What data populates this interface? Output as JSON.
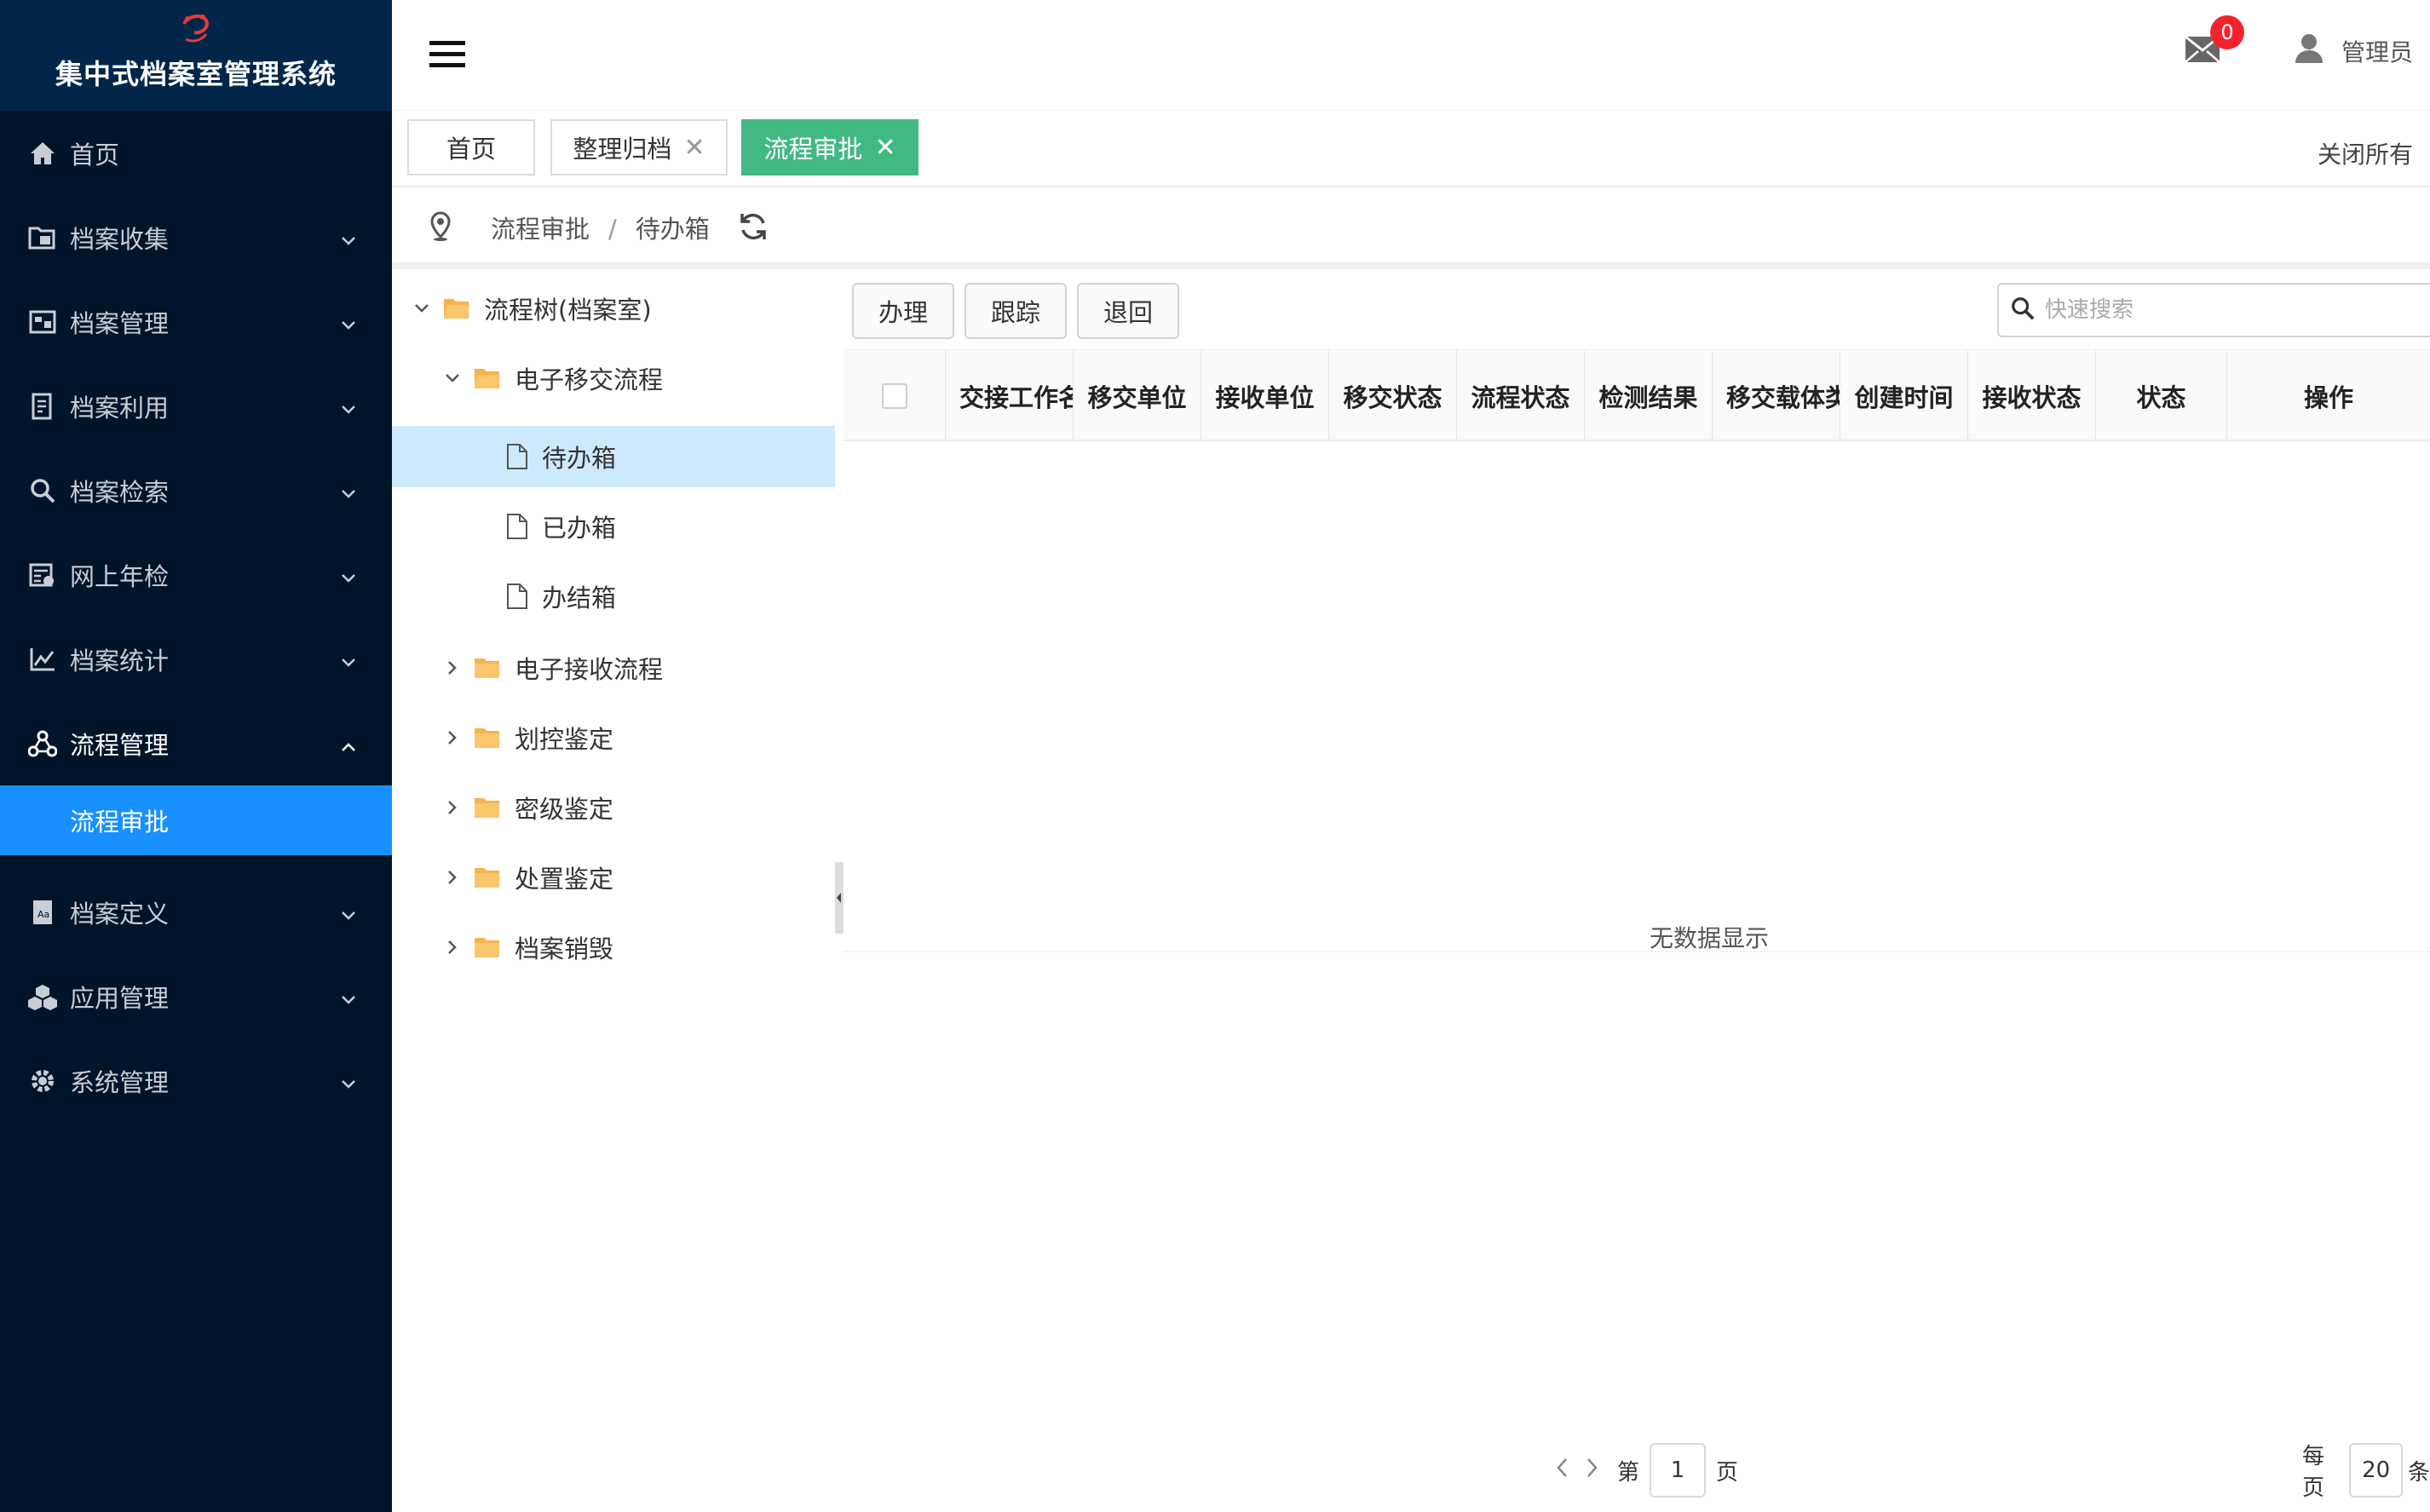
{
  "app": {
    "title": "集中式档案室管理系统"
  },
  "sidebar": {
    "items": [
      {
        "label": "首页",
        "icon": "home-icon"
      },
      {
        "label": "档案收集",
        "icon": "folder-collect-icon"
      },
      {
        "label": "档案管理",
        "icon": "archive-manage-icon"
      },
      {
        "label": "档案利用",
        "icon": "document-use-icon"
      },
      {
        "label": "档案检索",
        "icon": "search-icon"
      },
      {
        "label": "网上年检",
        "icon": "calendar-check-icon"
      },
      {
        "label": "档案统计",
        "icon": "line-chart-icon"
      },
      {
        "label": "流程管理",
        "icon": "workflow-icon"
      },
      {
        "label": "档案定义",
        "icon": "book-define-icon"
      },
      {
        "label": "应用管理",
        "icon": "cubes-icon"
      },
      {
        "label": "系统管理",
        "icon": "gear-icon"
      }
    ],
    "active_sub": "流程审批"
  },
  "header": {
    "mail_count": "0",
    "user": "管理员"
  },
  "tabs": {
    "items": [
      "首页",
      "整理归档",
      "流程审批"
    ],
    "close_all": "关闭所有"
  },
  "breadcrumb": {
    "items": [
      "流程审批",
      "待办箱"
    ],
    "sep": "/"
  },
  "tree": {
    "root": "流程树(档案室)",
    "nodes": [
      {
        "label": "电子移交流程"
      },
      {
        "label": "待办箱"
      },
      {
        "label": "已办箱"
      },
      {
        "label": "办结箱"
      },
      {
        "label": "电子接收流程"
      },
      {
        "label": "划控鉴定"
      },
      {
        "label": "密级鉴定"
      },
      {
        "label": "处置鉴定"
      },
      {
        "label": "档案销毁"
      }
    ]
  },
  "toolbar": {
    "buttons": [
      "办理",
      "跟踪",
      "退回"
    ],
    "search_placeholder": "快速搜索"
  },
  "table": {
    "columns": [
      "交接工作名称",
      "移交单位",
      "接收单位",
      "移交状态",
      "流程状态",
      "检测结果",
      "移交载体类型",
      "创建时间",
      "接收状态",
      "状态",
      "操作"
    ],
    "empty_text": "无数据显示"
  },
  "pager": {
    "page_prefix": "第",
    "page": "1",
    "page_suffix": "页",
    "per_page_prefix": "每页",
    "per_page": "20",
    "per_page_suffix": "条"
  },
  "colors": {
    "sidebar_bg": "#001529",
    "active_blue": "#1890ff",
    "tab_active": "#42b983",
    "badge_red": "#f5222d",
    "folder": "#f6b44b"
  }
}
